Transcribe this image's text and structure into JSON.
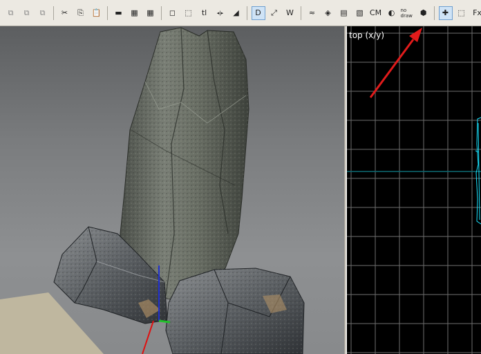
{
  "toolbar": {
    "buttons": [
      {
        "name": "carve-icon",
        "glyph": "⧉",
        "state": "dim"
      },
      {
        "name": "hollow-icon",
        "glyph": "⧉",
        "state": "dim"
      },
      {
        "name": "merge-icon",
        "glyph": "⧉",
        "state": "dim"
      },
      {
        "name": "sep"
      },
      {
        "name": "cut-icon",
        "glyph": "✂",
        "state": "normal"
      },
      {
        "name": "copy-icon",
        "glyph": "⎘",
        "state": "normal"
      },
      {
        "name": "paste-icon",
        "glyph": "📋",
        "state": "normal"
      },
      {
        "name": "sep"
      },
      {
        "name": "group-icon",
        "glyph": "▬",
        "state": "normal"
      },
      {
        "name": "select-all-icon",
        "glyph": "▦",
        "state": "normal"
      },
      {
        "name": "deselect-icon",
        "glyph": "▦",
        "state": "normal"
      },
      {
        "name": "sep"
      },
      {
        "name": "clipper-icon",
        "glyph": "◻",
        "state": "normal"
      },
      {
        "name": "region-select-icon",
        "glyph": "⬚",
        "state": "normal"
      },
      {
        "name": "texture-lock-icon",
        "glyph": "tl",
        "state": "normal"
      },
      {
        "name": "flip-icon",
        "glyph": "◂|▸",
        "state": "normal"
      },
      {
        "name": "rotate-icon",
        "glyph": "◢",
        "state": "normal"
      },
      {
        "name": "sep"
      },
      {
        "name": "csg-subtract-icon",
        "glyph": "D",
        "state": "pressed"
      },
      {
        "name": "csg-merge-icon",
        "glyph": "⤢",
        "state": "normal"
      },
      {
        "name": "csg-hollow-icon",
        "glyph": "W",
        "state": "normal"
      },
      {
        "name": "sep"
      },
      {
        "name": "curve-icon",
        "glyph": "≈",
        "state": "normal"
      },
      {
        "name": "camera-icon",
        "glyph": "◈",
        "state": "normal"
      },
      {
        "name": "wireframe-icon",
        "glyph": "▤",
        "state": "normal"
      },
      {
        "name": "cubes-icon",
        "glyph": "▧",
        "state": "normal"
      },
      {
        "name": "cm-toggle-icon",
        "glyph": "CM",
        "state": "normal"
      },
      {
        "name": "lighting-icon",
        "glyph": "◐",
        "state": "normal"
      },
      {
        "name": "nodraw-icon",
        "glyph": "no draw",
        "state": "normal"
      },
      {
        "name": "entity-icon",
        "glyph": "⬢",
        "state": "normal"
      },
      {
        "name": "sep"
      },
      {
        "name": "snap-icon",
        "glyph": "✚",
        "state": "pressed"
      },
      {
        "name": "grid-icon",
        "glyph": "⬚",
        "state": "normal"
      },
      {
        "name": "fx-icon",
        "glyph": "Fx",
        "state": "normal"
      }
    ]
  },
  "viewports": {
    "top_label": "top (x/y)"
  },
  "colors": {
    "grid_line": "#6f6f6f",
    "axis_line": "#0d6a73",
    "brush": "#19e3ff",
    "arrow": "#e11b1b",
    "pressed_bg": "#cfe3f6",
    "sky_top": "#5c5e60",
    "sky_bottom": "#888a8c",
    "sand": "#bfb79f"
  }
}
